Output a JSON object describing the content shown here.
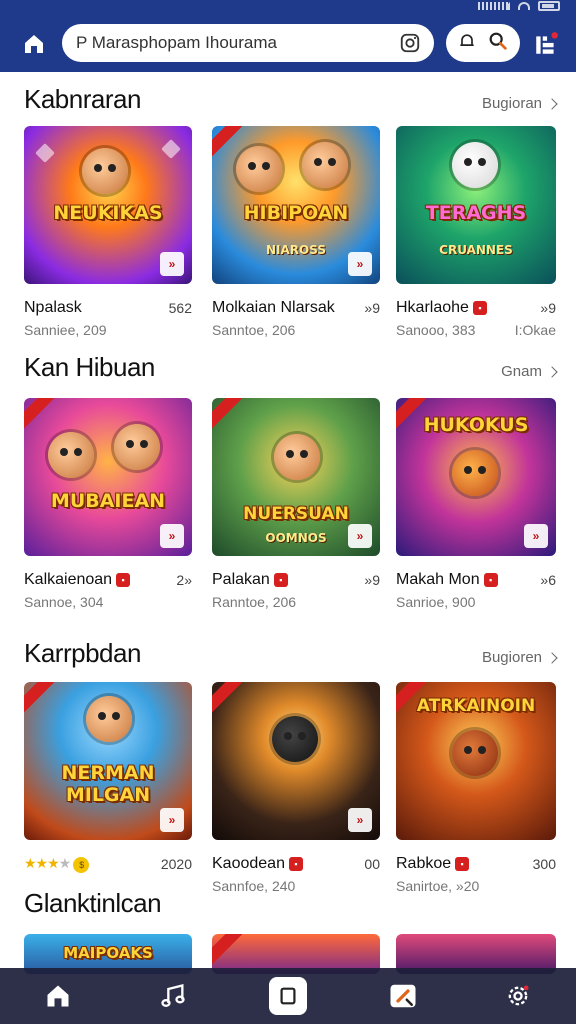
{
  "header": {
    "search": {
      "value": "P Marasphopam Ihourama",
      "placeholder": "P Marasphopam Ihourama"
    }
  },
  "sections": [
    {
      "title": "Kabnraran",
      "see_all": "Bugioran",
      "cards": [
        {
          "name": "Npalask",
          "sub": "Sanniee, 209",
          "num": "562",
          "art": "NEUKIKAS",
          "tag": false,
          "badge": "»"
        },
        {
          "name": "Molkaian Nlarsak",
          "sub": "Sanntoe, 206",
          "num": "»9",
          "art": "HIBIPOAN",
          "art_sub": "NIAROSS",
          "tag": false,
          "badge": "»"
        },
        {
          "name": "Hkarlaohe",
          "sub": "Sanooo, 383",
          "num": "»9",
          "sub_right": "I:Okae",
          "art": "TERAGHS",
          "art_sub": "CRUANNES",
          "tag": true
        }
      ]
    },
    {
      "title": "Kan Hibuan",
      "see_all": "Gnam",
      "cards": [
        {
          "name": "Kalkaienoan",
          "sub": "Sannoe, 304",
          "num": "2»",
          "art": "MUBAIEAN",
          "tag": true,
          "badge": "»"
        },
        {
          "name": "Palakan",
          "sub": "Ranntoe, 206",
          "num": "»9",
          "art": "NUERSUAN",
          "art_sub": "OOMNOS",
          "tag": true,
          "badge": "»"
        },
        {
          "name": "Makah Mon",
          "sub": "Sanrioe, 900",
          "num": "»6",
          "art": "HUKOKUS",
          "tag": true,
          "badge": "»"
        }
      ]
    },
    {
      "title": "Karrpbdan",
      "see_all": "Bugioren",
      "cards": [
        {
          "rating_num": "2020",
          "art": "NERMAN",
          "art_sub": "MILGAN",
          "badge": "»",
          "stars": 3
        },
        {
          "name": "Kaoodean",
          "sub": "Sannfoe, 240",
          "num": "00",
          "art": "",
          "tag": true,
          "badge": "»"
        },
        {
          "name": "Rabkoe",
          "sub": "Sanirtoe, »20",
          "num": "300",
          "art": "ATRKAINOIN",
          "tag": true
        }
      ]
    },
    {
      "title": "Glanktinlcan",
      "cards": [
        {
          "art": "MAIPOAKS"
        },
        {
          "art": ""
        },
        {
          "art": ""
        }
      ]
    }
  ],
  "icons": {
    "home": "home-icon",
    "camera": "camera-icon",
    "bell": "bell-icon",
    "search": "search-icon",
    "menu": "menu-icon",
    "music": "music-icon",
    "square": "square-icon",
    "draw": "draw-icon",
    "settings": "gear-icon"
  },
  "colors": {
    "header_bg": "#1f3a8a",
    "accent_red": "#d62020",
    "star": "#f0b400",
    "nav_bg": "#1c1e3a"
  }
}
